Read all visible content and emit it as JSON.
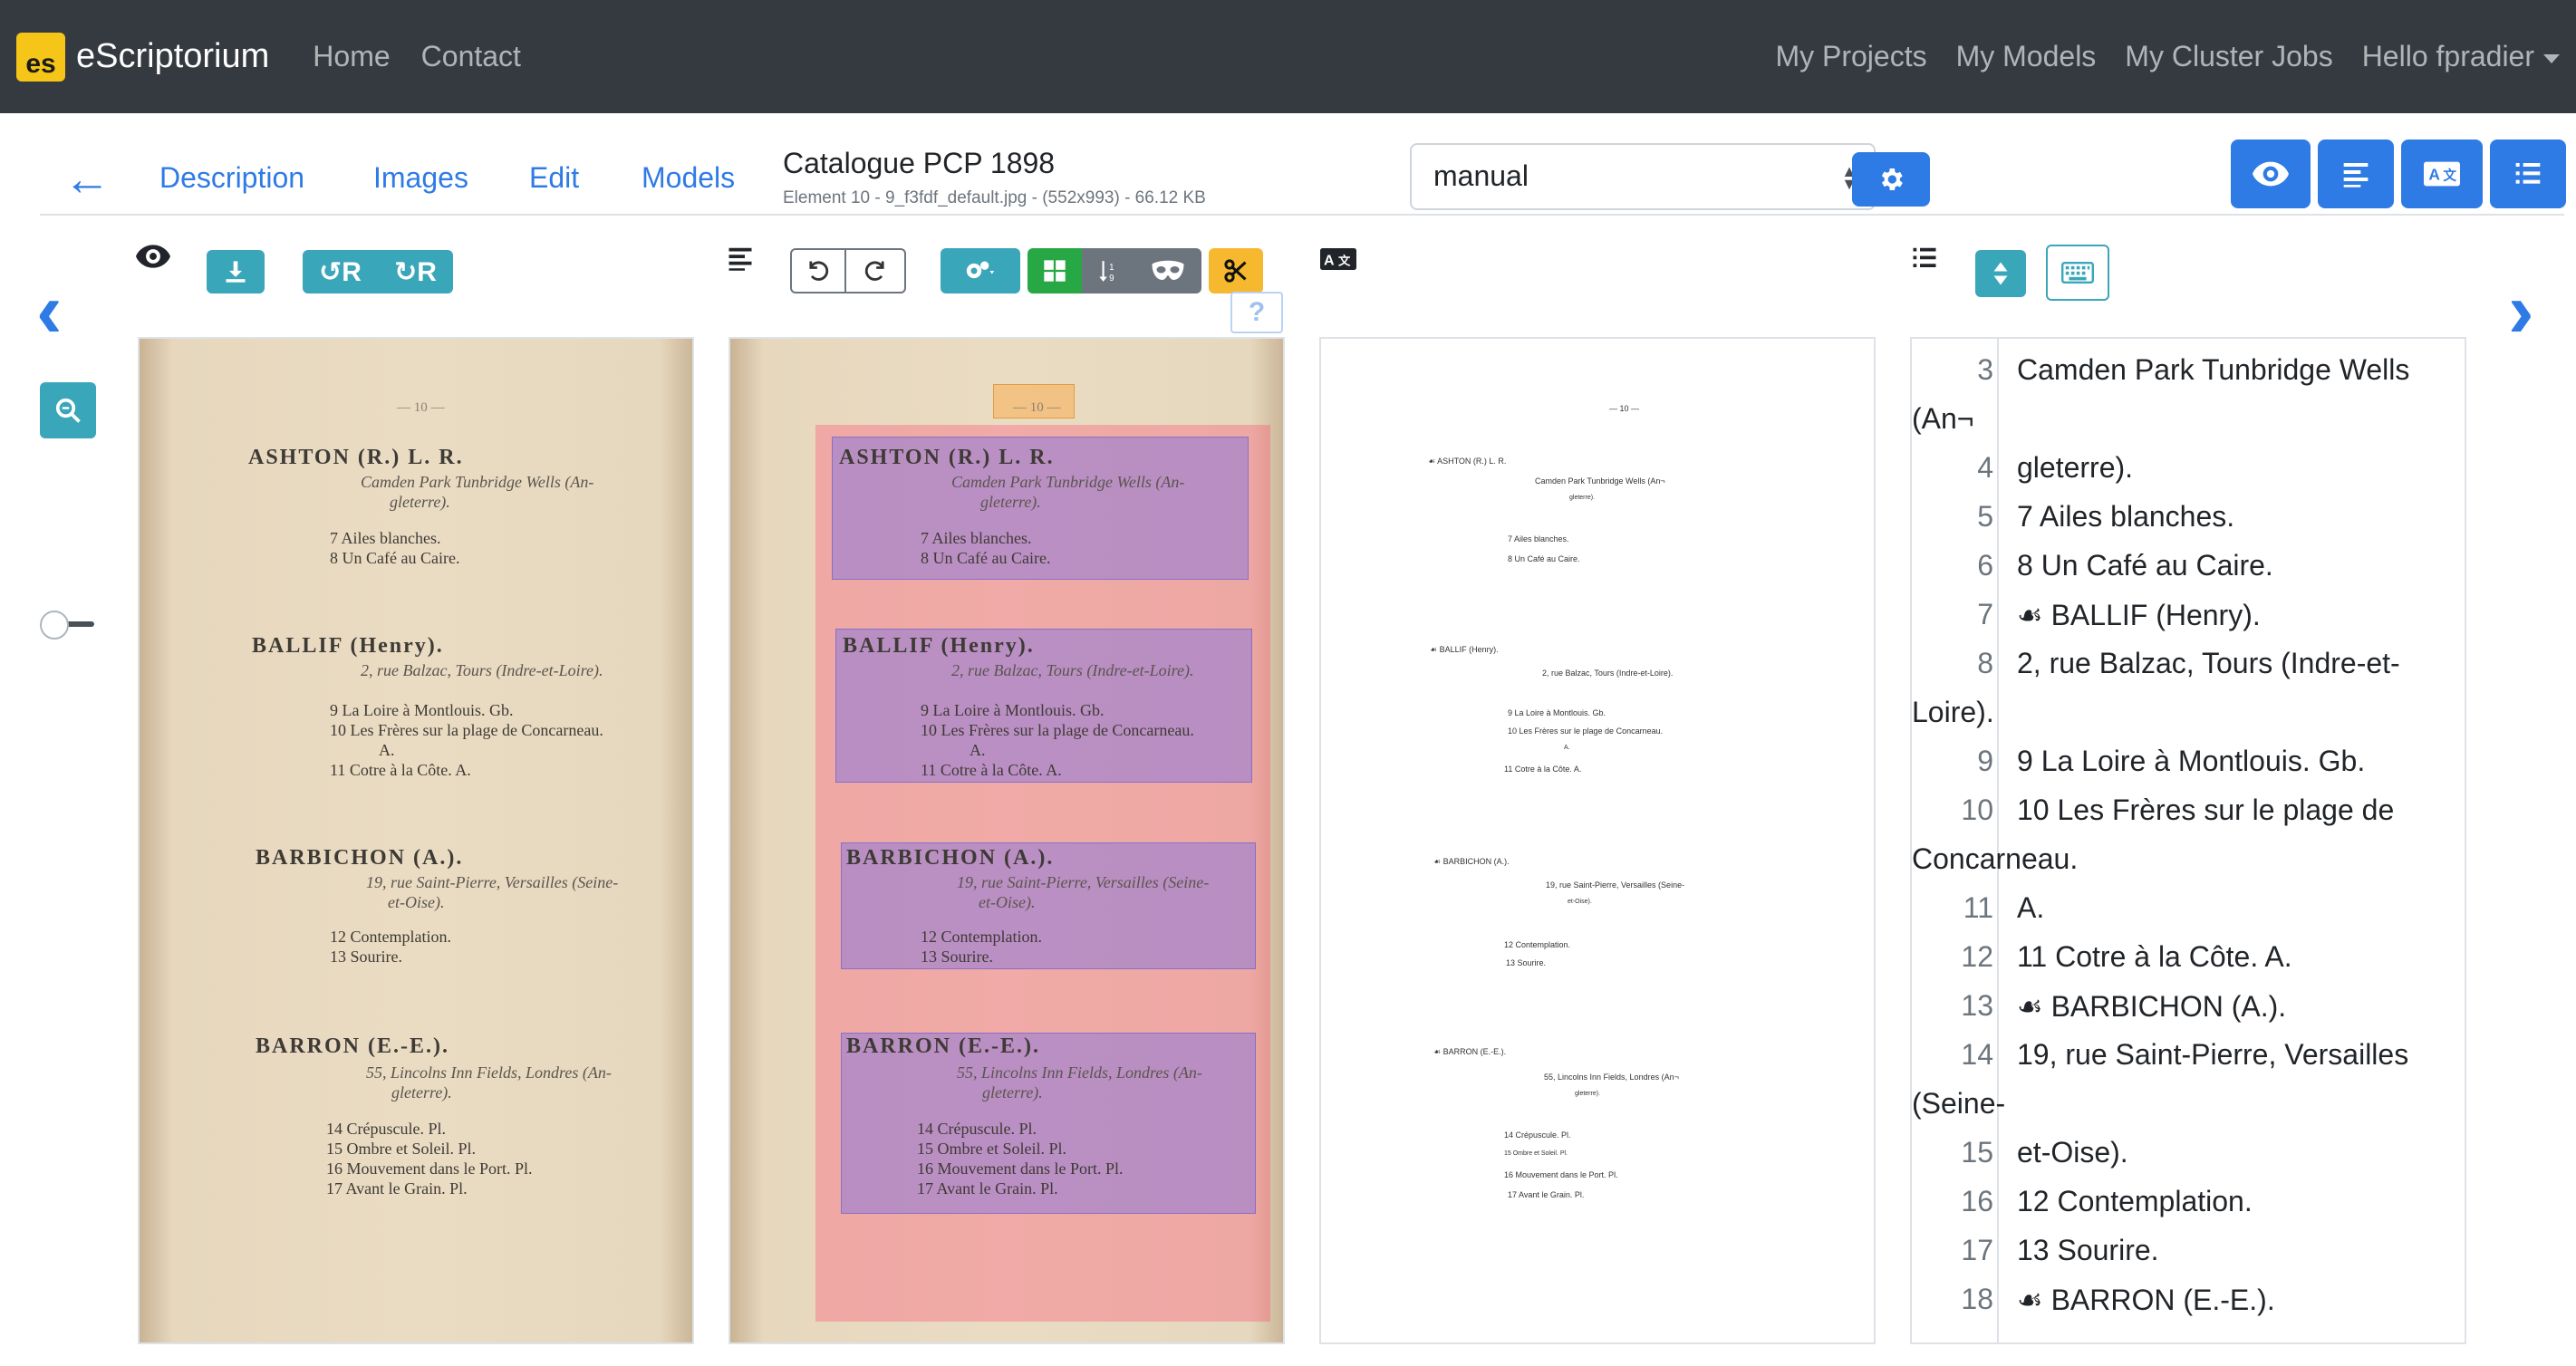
{
  "navbar": {
    "brand": "eScriptorium",
    "logo_text": "es",
    "left_links": [
      "Home",
      "Contact"
    ],
    "right_links": [
      "My Projects",
      "My Models",
      "My Cluster Jobs"
    ],
    "user_menu": "Hello fpradier"
  },
  "doc_tabs": [
    "Description",
    "Images",
    "Edit",
    "Models"
  ],
  "document": {
    "title": "Catalogue PCP 1898",
    "subtitle": "Element 10 - 9_f3fdf_default.jpg - (552x993) - 66.12 KB"
  },
  "transcription_select": {
    "value": "manual"
  },
  "help_label": "?",
  "scan": {
    "page_number": "— 10 —",
    "entries": [
      {
        "name": "ASHTON (R.) L. R.",
        "address": "Camden Park Tunbridge Wells (An-",
        "address2": "gleterre).",
        "lines": [
          "7 Ailes blanches.",
          "8 Un Café au Caire."
        ]
      },
      {
        "name": "BALLIF (Henry).",
        "address": "2, rue Balzac, Tours (Indre-et-Loire).",
        "address2": "",
        "lines": [
          "9 La Loire à Montlouis. Gb.",
          "10 Les Frères sur la plage de Concarneau.",
          "A.",
          "11 Cotre à la Côte. A."
        ]
      },
      {
        "name": "BARBICHON (A.).",
        "address": "19, rue Saint-Pierre, Versailles (Seine-",
        "address2": "et-Oise).",
        "lines": [
          "12 Contemplation.",
          "13 Sourire."
        ]
      },
      {
        "name": "BARRON (E.-E.).",
        "address": "55, Lincolns Inn Fields, Londres (An-",
        "address2": "gleterre).",
        "lines": [
          "14 Crépuscule. Pl.",
          "15 Ombre et Soleil. Pl.",
          "16 Mouvement dans le Port. Pl.",
          "17 Avant le Grain. Pl."
        ]
      }
    ]
  },
  "preview": {
    "page_number": "— 10 —",
    "lines": [
      "☙ ASHTON (R.) L. R.",
      "Camden Park Tunbridge Wells (An¬",
      "gleterre).",
      "7 Ailes blanches.",
      "8 Un Café au Caire.",
      "☙ BALLIF (Henry).",
      "2, rue Balzac, Tours (Indre-et-Loire).",
      "9 La Loire à Montlouis. Gb.",
      "10 Les Frères sur le plage de Concarneau.",
      "A.",
      "11 Cotre à la Côte. A.",
      "☙ BARBICHON (A.).",
      "19, rue Saint-Pierre, Versailles (Seine-",
      "et-Oise).",
      "12 Contemplation.",
      "13 Sourire.",
      "☙ BARRON (E.-E.).",
      "55, Lincolns Inn Fields, Londres (An¬",
      "gleterre).",
      "14 Crépuscule. Pl.",
      "15 Ombre et Soleil. Pl.",
      "16 Mouvement dans le Port. Pl.",
      "17 Avant le Grain. Pl."
    ]
  },
  "line_list": [
    {
      "n": "3",
      "text": "Camden Park Tunbridge Wells",
      "wrap": "(An¬"
    },
    {
      "n": "4",
      "text": "gleterre).",
      "wrap": ""
    },
    {
      "n": "5",
      "text": "7 Ailes blanches.",
      "wrap": ""
    },
    {
      "n": "6",
      "text": "8 Un Café au Caire.",
      "wrap": ""
    },
    {
      "n": "7",
      "text": "☙ BALLIF (Henry).",
      "wrap": ""
    },
    {
      "n": "8",
      "text": "2, rue Balzac, Tours (Indre-et-",
      "wrap": "Loire)."
    },
    {
      "n": "9",
      "text": "9 La Loire à Montlouis. Gb.",
      "wrap": ""
    },
    {
      "n": "10",
      "text": "10 Les Frères sur le plage de",
      "wrap": "Concarneau."
    },
    {
      "n": "11",
      "text": "A.",
      "wrap": ""
    },
    {
      "n": "12",
      "text": "11 Cotre à la Côte. A.",
      "wrap": ""
    },
    {
      "n": "13",
      "text": "☙ BARBICHON (A.).",
      "wrap": ""
    },
    {
      "n": "14",
      "text": "19, rue Saint-Pierre, Versailles",
      "wrap": "(Seine-"
    },
    {
      "n": "15",
      "text": "et-Oise).",
      "wrap": ""
    },
    {
      "n": "16",
      "text": "12 Contemplation.",
      "wrap": ""
    },
    {
      "n": "17",
      "text": "13 Sourire.",
      "wrap": ""
    },
    {
      "n": "18",
      "text": "☙ BARRON (E.-E.).",
      "wrap": ""
    }
  ],
  "icons": {
    "back": "arrow-left-icon",
    "prev": "chevron-left-icon",
    "next": "chevron-right-icon",
    "zoom": "zoom-icon",
    "visibility": "eye-icon",
    "download": "download-icon",
    "rotate_left": "rotate-left-icon",
    "rotate_right": "rotate-right-icon",
    "segmentation": "segmentation-icon",
    "undo": "undo-icon",
    "redo": "redo-icon",
    "settings": "gear-icon",
    "regions": "regions-icon",
    "reorder": "reorder-icon",
    "mask": "mask-icon",
    "cut": "scissors-icon",
    "translate": "translate-icon",
    "list": "list-icon",
    "sort": "sort-icon",
    "keyboard": "keyboard-icon"
  },
  "colors": {
    "primary": "#2f7be5",
    "navbar": "#343a40",
    "teal": "#3aa6b9",
    "green": "#28a745",
    "yellow": "#f5b82e",
    "region_fill": "#ff466e",
    "line_fill": "#786ee6"
  }
}
